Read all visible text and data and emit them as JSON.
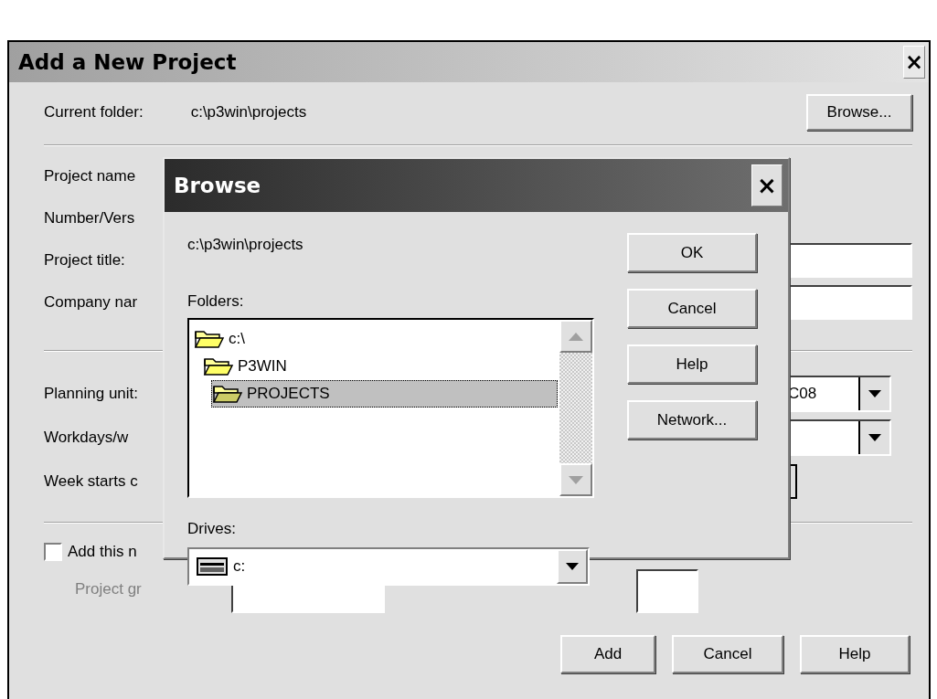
{
  "window": {
    "title": "Add a New Project",
    "close": "×"
  },
  "current_folder": {
    "label": "Current folder:",
    "value": "c:\\p3win\\projects"
  },
  "browse_button": "Browse...",
  "fields": [
    {
      "kind": "label",
      "label": "Project name"
    },
    {
      "kind": "label",
      "label": "Number/Vers"
    },
    {
      "kind": "input",
      "label": "Project title:"
    },
    {
      "kind": "input",
      "label": "Company nar"
    }
  ],
  "settings": [
    {
      "kind": "combo",
      "label": "Planning unit:",
      "value": "C08"
    },
    {
      "kind": "combo",
      "label": "Workdays/w"
    },
    {
      "kind": "box",
      "label": "Week starts c"
    }
  ],
  "checkbox": {
    "label": "Add this n",
    "checked": false
  },
  "group": {
    "label": "Project gr",
    "disabled": true
  },
  "buttons": [
    "Add",
    "Cancel",
    "Help"
  ],
  "browse_dialog": {
    "title": "Browse",
    "close": "×",
    "path": "c:\\p3win\\projects",
    "folders_label": "Folders:",
    "folders": [
      {
        "name": "c:\\",
        "selected": false,
        "children": [
          {
            "name": "P3WIN",
            "selected": false,
            "children": [
              {
                "name": "PROJECTS",
                "selected": true
              }
            ]
          }
        ]
      }
    ],
    "drives_label": "Drives:",
    "drive": "c:",
    "buttons": [
      "OK",
      "Cancel",
      "Help",
      "Network..."
    ]
  }
}
